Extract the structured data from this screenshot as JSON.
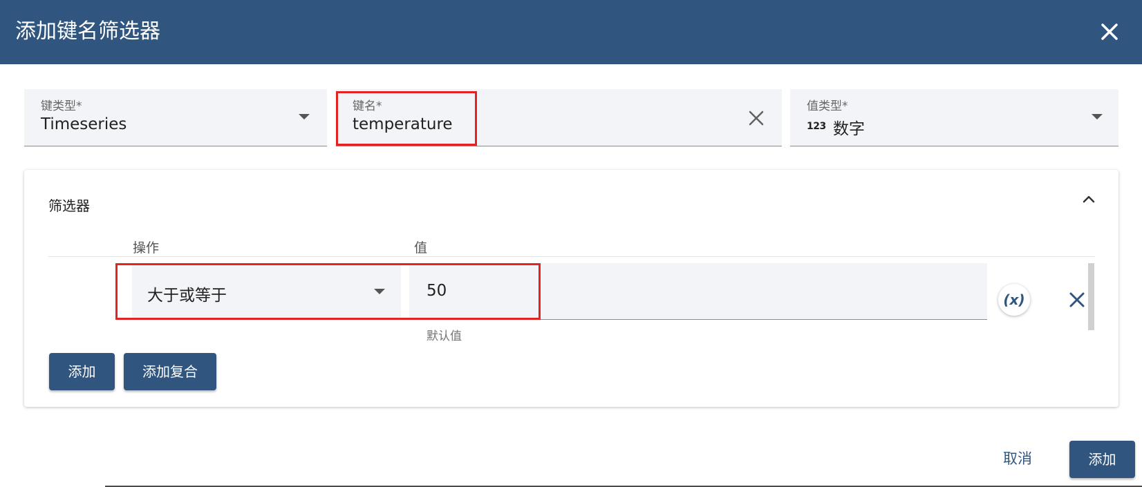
{
  "dialog": {
    "title": "添加键名筛选器"
  },
  "fields": {
    "key_type": {
      "label": "键类型*",
      "value": "Timeseries"
    },
    "key_name": {
      "label": "键名*",
      "value": "temperature"
    },
    "value_type": {
      "label": "值类型*",
      "icon_text": "123",
      "value": "数字"
    }
  },
  "filters_panel": {
    "title": "筛选器",
    "columns": {
      "operation": "操作",
      "value": "值"
    },
    "row": {
      "operation": "大于或等于",
      "value": "50",
      "hint": "默认值",
      "variable_button": "(x)"
    },
    "buttons": {
      "add": "添加",
      "add_complex": "添加复合"
    }
  },
  "footer": {
    "cancel": "取消",
    "add": "添加"
  },
  "colors": {
    "header_bg": "#305680",
    "accent": "#305680",
    "highlight_border": "#e32222",
    "field_bg": "#f3f4f7"
  }
}
